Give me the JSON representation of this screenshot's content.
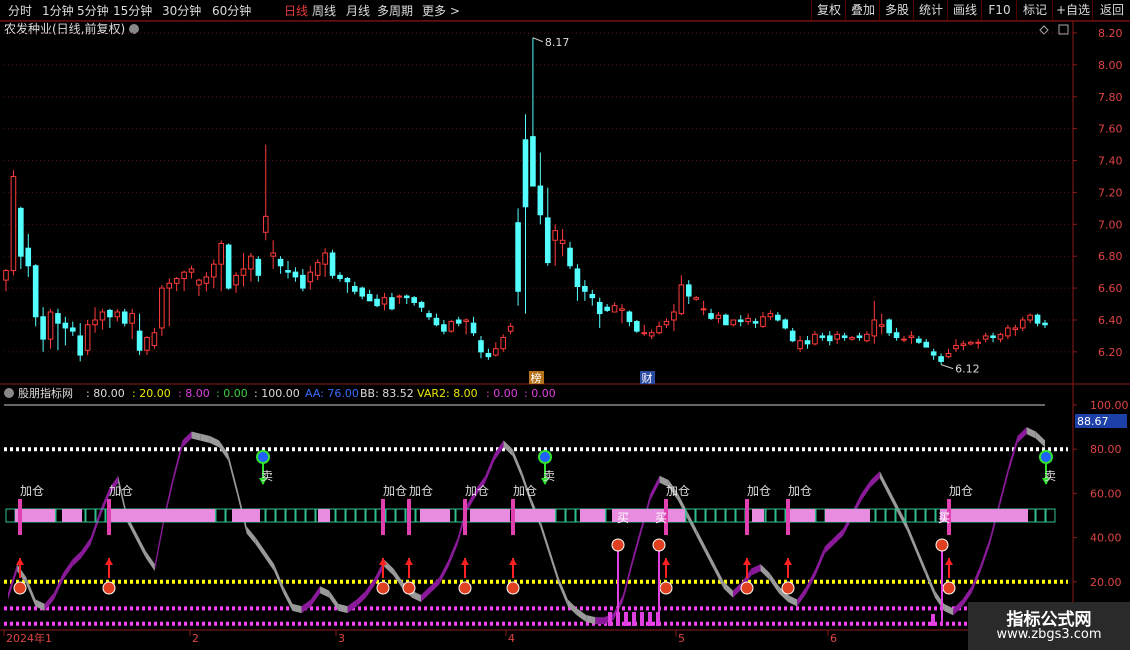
{
  "toolbar": {
    "periods": [
      "分时",
      "1分钟",
      "5分钟",
      "15分钟",
      "30分钟",
      "60分钟",
      "日线",
      "周线",
      "月线",
      "多周期",
      "更多 >"
    ],
    "active_period": "日线",
    "right_buttons": [
      "复权",
      "叠加",
      "多股",
      "统计",
      "画线",
      "F10",
      "标记",
      "+自选",
      "返回"
    ]
  },
  "main_title": "农发种业(日线,前复权)",
  "price_axis": [
    "8.20",
    "8.00",
    "7.80",
    "7.60",
    "7.40",
    "7.20",
    "7.00",
    "6.80",
    "6.60",
    "6.40",
    "6.20"
  ],
  "annotations": {
    "high": "8.17",
    "low": "6.12",
    "tag_bang": "榜",
    "tag_cai": "财"
  },
  "indicator": {
    "name": "股朋指标网",
    "values": [
      ": 80.00",
      ": 20.00",
      ": 8.00",
      ": 0.00",
      ": 100.00",
      "AA: 76.00",
      "BB: 83.52",
      "VAR2: 8.00",
      ": 0.00",
      ": 0.00"
    ],
    "value_colors": [
      "#dddddd",
      "#e8e800",
      "#e040e0",
      "#40d040",
      "#dddddd",
      "#3a6cff",
      "#dddddd",
      "#e8e800",
      "#e040e0",
      "#e040e0"
    ],
    "axis": [
      "100.00",
      "80.00",
      "60.00",
      "40.00",
      "20.00"
    ],
    "current_value": "88.67",
    "jiacang": "加仓",
    "mai": "卖",
    "mai2": "买"
  },
  "date_axis": [
    "2024年1",
    "2",
    "3",
    "4",
    "5",
    "6"
  ],
  "watermark": {
    "line1": "指标公式网",
    "line2": "www.zbgs3.com"
  },
  "colors": {
    "up": "#ff3b3b",
    "down": "#54ffff",
    "frame": "#8b1a1a",
    "grid": "#5a1010",
    "purple": "#8b1a9a",
    "gray": "#9a9a9a",
    "white_dot": "#ffffff",
    "yellow": "#ffff00",
    "magenta": "#ff40ff",
    "pink": "#e88ce0"
  },
  "chart_data": {
    "type": "candlestick",
    "ylim": [
      6.08,
      8.25
    ],
    "ohlc": [
      [
        6.65,
        6.72,
        6.58,
        6.71
      ],
      [
        6.71,
        7.34,
        6.68,
        7.3
      ],
      [
        7.1,
        7.11,
        6.72,
        6.8
      ],
      [
        6.85,
        6.94,
        6.67,
        6.74
      ],
      [
        6.74,
        6.75,
        6.36,
        6.42
      ],
      [
        6.42,
        6.48,
        6.2,
        6.28
      ],
      [
        6.28,
        6.47,
        6.22,
        6.45
      ],
      [
        6.44,
        6.47,
        6.21,
        6.38
      ],
      [
        6.38,
        6.42,
        6.24,
        6.35
      ],
      [
        6.35,
        6.39,
        6.3,
        6.33
      ],
      [
        6.3,
        6.38,
        6.14,
        6.18
      ],
      [
        6.21,
        6.4,
        6.18,
        6.37
      ],
      [
        6.37,
        6.48,
        6.32,
        6.4
      ],
      [
        6.4,
        6.47,
        6.34,
        6.45
      ],
      [
        6.46,
        6.47,
        6.35,
        6.42
      ],
      [
        6.42,
        6.47,
        6.39,
        6.45
      ],
      [
        6.45,
        6.47,
        6.36,
        6.38
      ],
      [
        6.38,
        6.47,
        6.28,
        6.44
      ],
      [
        6.33,
        6.44,
        6.18,
        6.21
      ],
      [
        6.21,
        6.3,
        6.18,
        6.29
      ],
      [
        6.24,
        6.35,
        6.22,
        6.32
      ],
      [
        6.35,
        6.62,
        6.3,
        6.6
      ],
      [
        6.6,
        6.66,
        6.36,
        6.63
      ],
      [
        6.63,
        6.67,
        6.58,
        6.66
      ],
      [
        6.66,
        6.71,
        6.58,
        6.7
      ],
      [
        6.7,
        6.74,
        6.66,
        6.72
      ],
      [
        6.62,
        6.66,
        6.55,
        6.65
      ],
      [
        6.63,
        6.7,
        6.58,
        6.67
      ],
      [
        6.67,
        6.78,
        6.6,
        6.75
      ],
      [
        6.75,
        6.9,
        6.58,
        6.88
      ],
      [
        6.87,
        6.88,
        6.59,
        6.6
      ],
      [
        6.62,
        6.7,
        6.57,
        6.68
      ],
      [
        6.68,
        6.82,
        6.61,
        6.72
      ],
      [
        6.72,
        6.82,
        6.64,
        6.8
      ],
      [
        6.78,
        6.8,
        6.64,
        6.68
      ],
      [
        6.95,
        7.5,
        6.9,
        7.05
      ],
      [
        6.8,
        6.9,
        6.72,
        6.82
      ],
      [
        6.78,
        6.8,
        6.69,
        6.74
      ],
      [
        6.71,
        6.77,
        6.66,
        6.7
      ],
      [
        6.7,
        6.73,
        6.64,
        6.67
      ],
      [
        6.68,
        6.72,
        6.58,
        6.6
      ],
      [
        6.64,
        6.74,
        6.59,
        6.7
      ],
      [
        6.68,
        6.78,
        6.65,
        6.76
      ],
      [
        6.75,
        6.85,
        6.67,
        6.82
      ],
      [
        6.82,
        6.84,
        6.66,
        6.68
      ],
      [
        6.68,
        6.7,
        6.64,
        6.66
      ],
      [
        6.66,
        6.67,
        6.57,
        6.64
      ],
      [
        6.61,
        6.64,
        6.56,
        6.58
      ],
      [
        6.6,
        6.61,
        6.53,
        6.55
      ],
      [
        6.56,
        6.59,
        6.52,
        6.52
      ],
      [
        6.53,
        6.56,
        6.48,
        6.49
      ],
      [
        6.5,
        6.57,
        6.46,
        6.54
      ],
      [
        6.54,
        6.57,
        6.46,
        6.47
      ],
      [
        6.55,
        6.56,
        6.5,
        6.55
      ],
      [
        6.55,
        6.56,
        6.5,
        6.54
      ],
      [
        6.54,
        6.55,
        6.49,
        6.51
      ],
      [
        6.51,
        6.52,
        6.45,
        6.48
      ],
      [
        6.44,
        6.46,
        6.4,
        6.42
      ],
      [
        6.41,
        6.44,
        6.36,
        6.37
      ],
      [
        6.37,
        6.4,
        6.31,
        6.33
      ],
      [
        6.33,
        6.4,
        6.32,
        6.39
      ],
      [
        6.4,
        6.42,
        6.36,
        6.38
      ],
      [
        6.39,
        6.41,
        6.31,
        6.4
      ],
      [
        6.38,
        6.42,
        6.3,
        6.32
      ],
      [
        6.27,
        6.3,
        6.16,
        6.2
      ],
      [
        6.19,
        6.22,
        6.15,
        6.17
      ],
      [
        6.18,
        6.26,
        6.17,
        6.22
      ],
      [
        6.22,
        6.31,
        6.2,
        6.29
      ],
      [
        6.33,
        6.38,
        6.31,
        6.36
      ],
      [
        7.01,
        7.1,
        6.49,
        6.58
      ],
      [
        7.53,
        7.69,
        6.44,
        7.11
      ],
      [
        7.55,
        8.17,
        7.28,
        7.24
      ],
      [
        7.24,
        7.45,
        7.0,
        7.06
      ],
      [
        7.04,
        7.23,
        6.74,
        6.76
      ],
      [
        6.9,
        7.0,
        6.74,
        6.96
      ],
      [
        6.88,
        6.97,
        6.8,
        6.9
      ],
      [
        6.85,
        6.89,
        6.72,
        6.74
      ],
      [
        6.72,
        6.75,
        6.52,
        6.61
      ],
      [
        6.61,
        6.65,
        6.52,
        6.58
      ],
      [
        6.56,
        6.59,
        6.49,
        6.54
      ],
      [
        6.51,
        6.54,
        6.35,
        6.44
      ],
      [
        6.48,
        6.5,
        6.45,
        6.46
      ],
      [
        6.45,
        6.51,
        6.46,
        6.49
      ],
      [
        6.46,
        6.5,
        6.38,
        6.47
      ],
      [
        6.45,
        6.46,
        6.36,
        6.39
      ],
      [
        6.39,
        6.4,
        6.32,
        6.33
      ],
      [
        6.32,
        6.37,
        6.3,
        6.32
      ],
      [
        6.3,
        6.34,
        6.28,
        6.32
      ],
      [
        6.32,
        6.39,
        6.31,
        6.36
      ],
      [
        6.37,
        6.41,
        6.35,
        6.39
      ],
      [
        6.4,
        6.5,
        6.33,
        6.45
      ],
      [
        6.44,
        6.68,
        6.43,
        6.62
      ],
      [
        6.62,
        6.65,
        6.5,
        6.55
      ],
      [
        6.53,
        6.55,
        6.52,
        6.54
      ],
      [
        6.47,
        6.52,
        6.43,
        6.47
      ],
      [
        6.44,
        6.47,
        6.4,
        6.41
      ],
      [
        6.41,
        6.45,
        6.38,
        6.43
      ],
      [
        6.43,
        6.44,
        6.37,
        6.37
      ],
      [
        6.37,
        6.4,
        6.36,
        6.4
      ],
      [
        6.4,
        6.43,
        6.36,
        6.39
      ],
      [
        6.39,
        6.44,
        6.37,
        6.41
      ],
      [
        6.39,
        6.41,
        6.35,
        6.38
      ],
      [
        6.36,
        6.45,
        6.35,
        6.42
      ],
      [
        6.42,
        6.46,
        6.4,
        6.44
      ],
      [
        6.43,
        6.45,
        6.39,
        6.4
      ],
      [
        6.4,
        6.41,
        6.34,
        6.35
      ],
      [
        6.33,
        6.35,
        6.26,
        6.27
      ],
      [
        6.22,
        6.3,
        6.2,
        6.27
      ],
      [
        6.27,
        6.3,
        6.22,
        6.25
      ],
      [
        6.25,
        6.33,
        6.24,
        6.31
      ],
      [
        6.3,
        6.32,
        6.27,
        6.29
      ],
      [
        6.3,
        6.33,
        6.24,
        6.27
      ],
      [
        6.28,
        6.33,
        6.25,
        6.31
      ],
      [
        6.3,
        6.32,
        6.27,
        6.29
      ],
      [
        6.28,
        6.3,
        6.27,
        6.29
      ],
      [
        6.3,
        6.32,
        6.27,
        6.29
      ],
      [
        6.27,
        6.33,
        6.26,
        6.31
      ],
      [
        6.3,
        6.52,
        6.25,
        6.4
      ],
      [
        6.36,
        6.44,
        6.31,
        6.37
      ],
      [
        6.4,
        6.41,
        6.3,
        6.32
      ],
      [
        6.32,
        6.35,
        6.27,
        6.29
      ],
      [
        6.28,
        6.3,
        6.26,
        6.28
      ],
      [
        6.29,
        6.33,
        6.25,
        6.3
      ],
      [
        6.28,
        6.3,
        6.25,
        6.26
      ],
      [
        6.26,
        6.28,
        6.23,
        6.23
      ],
      [
        6.2,
        6.22,
        6.15,
        6.18
      ],
      [
        6.17,
        6.19,
        6.12,
        6.14
      ],
      [
        6.17,
        6.22,
        6.16,
        6.19
      ],
      [
        6.22,
        6.28,
        6.2,
        6.24
      ],
      [
        6.24,
        6.27,
        6.21,
        6.25
      ],
      [
        6.25,
        6.27,
        6.24,
        6.26
      ],
      [
        6.26,
        6.28,
        6.22,
        6.26
      ],
      [
        6.28,
        6.32,
        6.26,
        6.3
      ],
      [
        6.3,
        6.32,
        6.26,
        6.29
      ],
      [
        6.28,
        6.32,
        6.26,
        6.31
      ],
      [
        6.3,
        6.37,
        6.28,
        6.35
      ],
      [
        6.34,
        6.37,
        6.3,
        6.35
      ],
      [
        6.35,
        6.42,
        6.33,
        6.4
      ],
      [
        6.4,
        6.44,
        6.38,
        6.43
      ],
      [
        6.43,
        6.44,
        6.36,
        6.38
      ],
      [
        6.38,
        6.4,
        6.35,
        6.37
      ]
    ]
  }
}
